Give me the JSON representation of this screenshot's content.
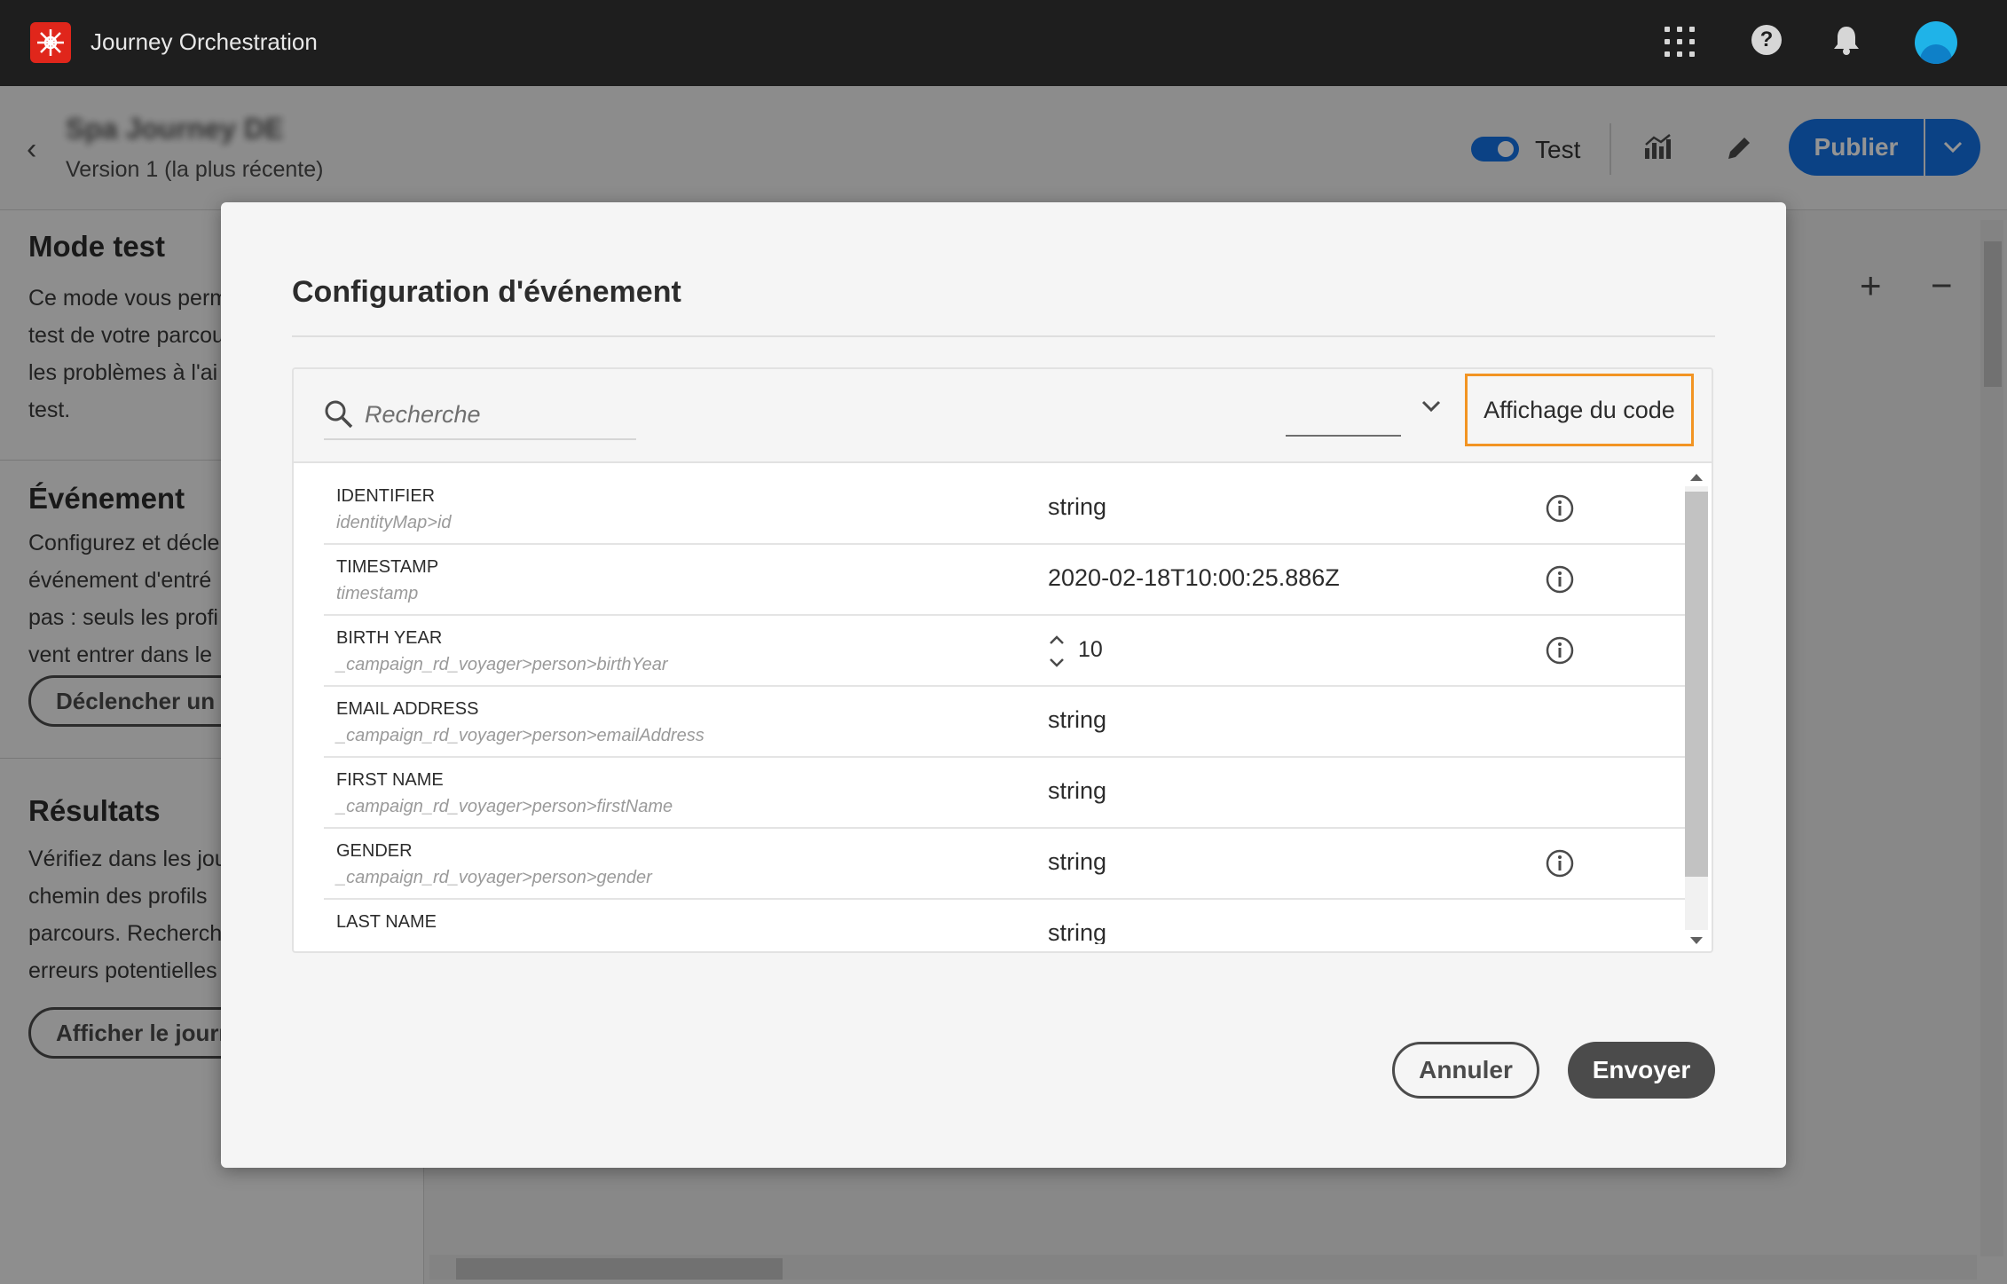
{
  "app": {
    "title": "Journey Orchestration"
  },
  "topbar": {
    "icons": [
      "app-switcher-icon",
      "help-icon",
      "bell-icon",
      "avatar"
    ]
  },
  "journey": {
    "name": "Spa Journey DE",
    "version": "Version 1 (la plus récente)",
    "test_label": "Test",
    "test_enabled": true,
    "publish_label": "Publier"
  },
  "left_panel": {
    "sections": [
      {
        "title": "Mode test",
        "text": "Ce mode vous perm\ntest de votre parcou\nles problèmes à l'ai\ntest."
      },
      {
        "title": "Événement",
        "text": "Configurez et décle\névénement d'entré\npas : seuls les profi\nvent entrer dans le",
        "button": "Déclencher un é"
      },
      {
        "title": "Résultats",
        "text": "Vérifiez dans les jou\nchemin des profils\nparcours. Recherch\nerreurs potentielles",
        "button": "Afficher le journ"
      }
    ]
  },
  "modal": {
    "title": "Configuration d'événement",
    "search_placeholder": "Recherche",
    "filter_value": "",
    "code_view_label": "Affichage du code",
    "cancel_label": "Annuler",
    "send_label": "Envoyer",
    "fields": [
      {
        "name": "IDENTIFIER",
        "path": "identityMap>id",
        "value": "string",
        "info": true
      },
      {
        "name": "TIMESTAMP",
        "path": "timestamp",
        "value": "2020-02-18T10:00:25.886Z",
        "info": true
      },
      {
        "name": "BIRTH YEAR",
        "path": "_campaign_rd_voyager>person>birthYear",
        "value": "10",
        "stepper": true,
        "info": true
      },
      {
        "name": "EMAIL ADDRESS",
        "path": "_campaign_rd_voyager>person>emailAddress",
        "value": "string",
        "info": false
      },
      {
        "name": "FIRST NAME",
        "path": "_campaign_rd_voyager>person>firstName",
        "value": "string",
        "info": false
      },
      {
        "name": "GENDER",
        "path": "_campaign_rd_voyager>person>gender",
        "value": "string",
        "info": true
      },
      {
        "name": "LAST NAME",
        "path": "",
        "value": "string",
        "info": false
      }
    ]
  },
  "canvas": {
    "zoom_in": "+",
    "zoom_out": "−"
  }
}
